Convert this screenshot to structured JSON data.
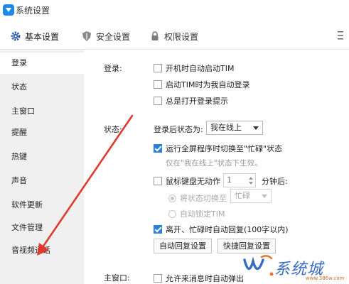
{
  "window": {
    "title": "系统设置"
  },
  "top_tabs": [
    {
      "label": "基本设置",
      "icon": "gear-icon",
      "active": true
    },
    {
      "label": "安全设置",
      "icon": "shield-icon",
      "active": false
    },
    {
      "label": "权限设置",
      "icon": "lock-icon",
      "active": false
    }
  ],
  "sidebar": {
    "items": [
      {
        "label": "登录",
        "active": true
      },
      {
        "label": "状态",
        "active": false
      },
      {
        "label": "主窗口",
        "active": false
      },
      {
        "label": "提醒",
        "active": false
      },
      {
        "label": "热键",
        "active": false
      },
      {
        "label": "声音",
        "active": false
      },
      {
        "label": "软件更新",
        "active": false
      },
      {
        "label": "文件管理",
        "active": false
      },
      {
        "label": "音视频通话",
        "active": false
      }
    ]
  },
  "login": {
    "label": "登录:",
    "options": [
      {
        "label": "开机时自动启动TIM",
        "checked": false
      },
      {
        "label": "启动TIM时为我自动登录",
        "checked": false
      },
      {
        "label": "总是打开登录提示",
        "checked": false
      }
    ]
  },
  "status": {
    "label": "状态:",
    "after_login_label": "登录后状态为:",
    "after_login_value": "我在线上",
    "fullscreen_busy": {
      "label": "运行全屏程序时切换至\"忙碌\"状态",
      "checked": true
    },
    "fullscreen_hint": "仅在\"我在线上\"状态下生效。",
    "idle": {
      "label": "鼠标键盘无动作",
      "checked": false,
      "minutes_value": "1",
      "minutes_suffix": "分钟后:"
    },
    "switch_status": {
      "label": "将状态切换至",
      "value": "忙碌",
      "selected": true
    },
    "auto_lock": {
      "label": "自动锁定TIM",
      "selected": false
    },
    "auto_reply": {
      "label": "离开、忙碌时自动回复(100字以内)",
      "checked": true
    },
    "auto_reply_settings_button": "自动回复设置",
    "quick_reply_settings_button": "快捷回复设置"
  },
  "main_window": {
    "label": "主窗口:",
    "option": {
      "label": "允许来消息时自动弹出",
      "checked": false
    }
  },
  "watermark": {
    "text": "系统城",
    "url": "www.386w.com"
  },
  "colors": {
    "accent": "#2e7fd9",
    "annotation_arrow": "#e03a2e",
    "sidebar_bg": "#f0f0f0"
  }
}
